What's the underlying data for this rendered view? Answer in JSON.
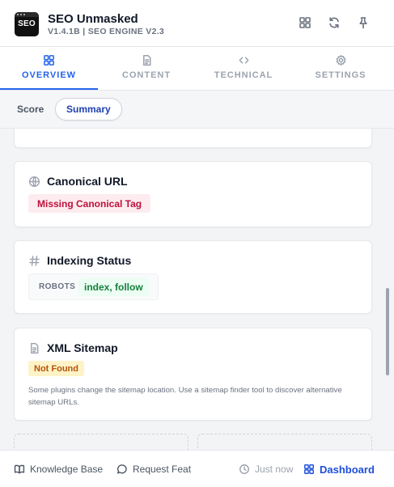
{
  "app": {
    "logo_text": "SEO",
    "name": "SEO Unmasked",
    "version": "V1.4.1B | SEO ENGINE V2.3"
  },
  "header_actions": [
    {
      "icon": "grid-icon"
    },
    {
      "icon": "refresh-icon"
    },
    {
      "icon": "pin-icon"
    }
  ],
  "tabs": [
    {
      "label": "OVERVIEW",
      "icon": "grid-icon",
      "active": true
    },
    {
      "label": "CONTENT",
      "icon": "document-icon",
      "active": false
    },
    {
      "label": "TECHNICAL",
      "icon": "code-icon",
      "active": false
    },
    {
      "label": "SETTINGS",
      "icon": "gear-icon",
      "active": false
    }
  ],
  "subtabs": [
    {
      "label": "Score",
      "active": false
    },
    {
      "label": "Summary",
      "active": true
    }
  ],
  "cards": {
    "canonical": {
      "icon": "globe-icon",
      "title": "Canonical URL",
      "badge": "Missing Canonical Tag"
    },
    "indexing": {
      "icon": "hash-icon",
      "title": "Indexing Status",
      "robots_key": "ROBOTS",
      "robots_value": "index, follow"
    },
    "sitemap": {
      "icon": "document-icon",
      "title": "XML Sitemap",
      "badge": "Not Found",
      "note": "Some plugins change the sitemap location. Use a sitemap finder tool to discover alternative sitemap URLs."
    }
  },
  "footer": {
    "knowledge_base": "Knowledge Base",
    "request_feat": "Request Feat",
    "last_updated": "Just now",
    "dashboard": "Dashboard"
  },
  "colors": {
    "accent": "#2563eb",
    "error": "#be123c",
    "error_bg": "#fdecef",
    "success": "#15803d",
    "success_bg": "#ecfdf3",
    "warning": "#b45309",
    "warning_bg": "#fef3c7"
  }
}
